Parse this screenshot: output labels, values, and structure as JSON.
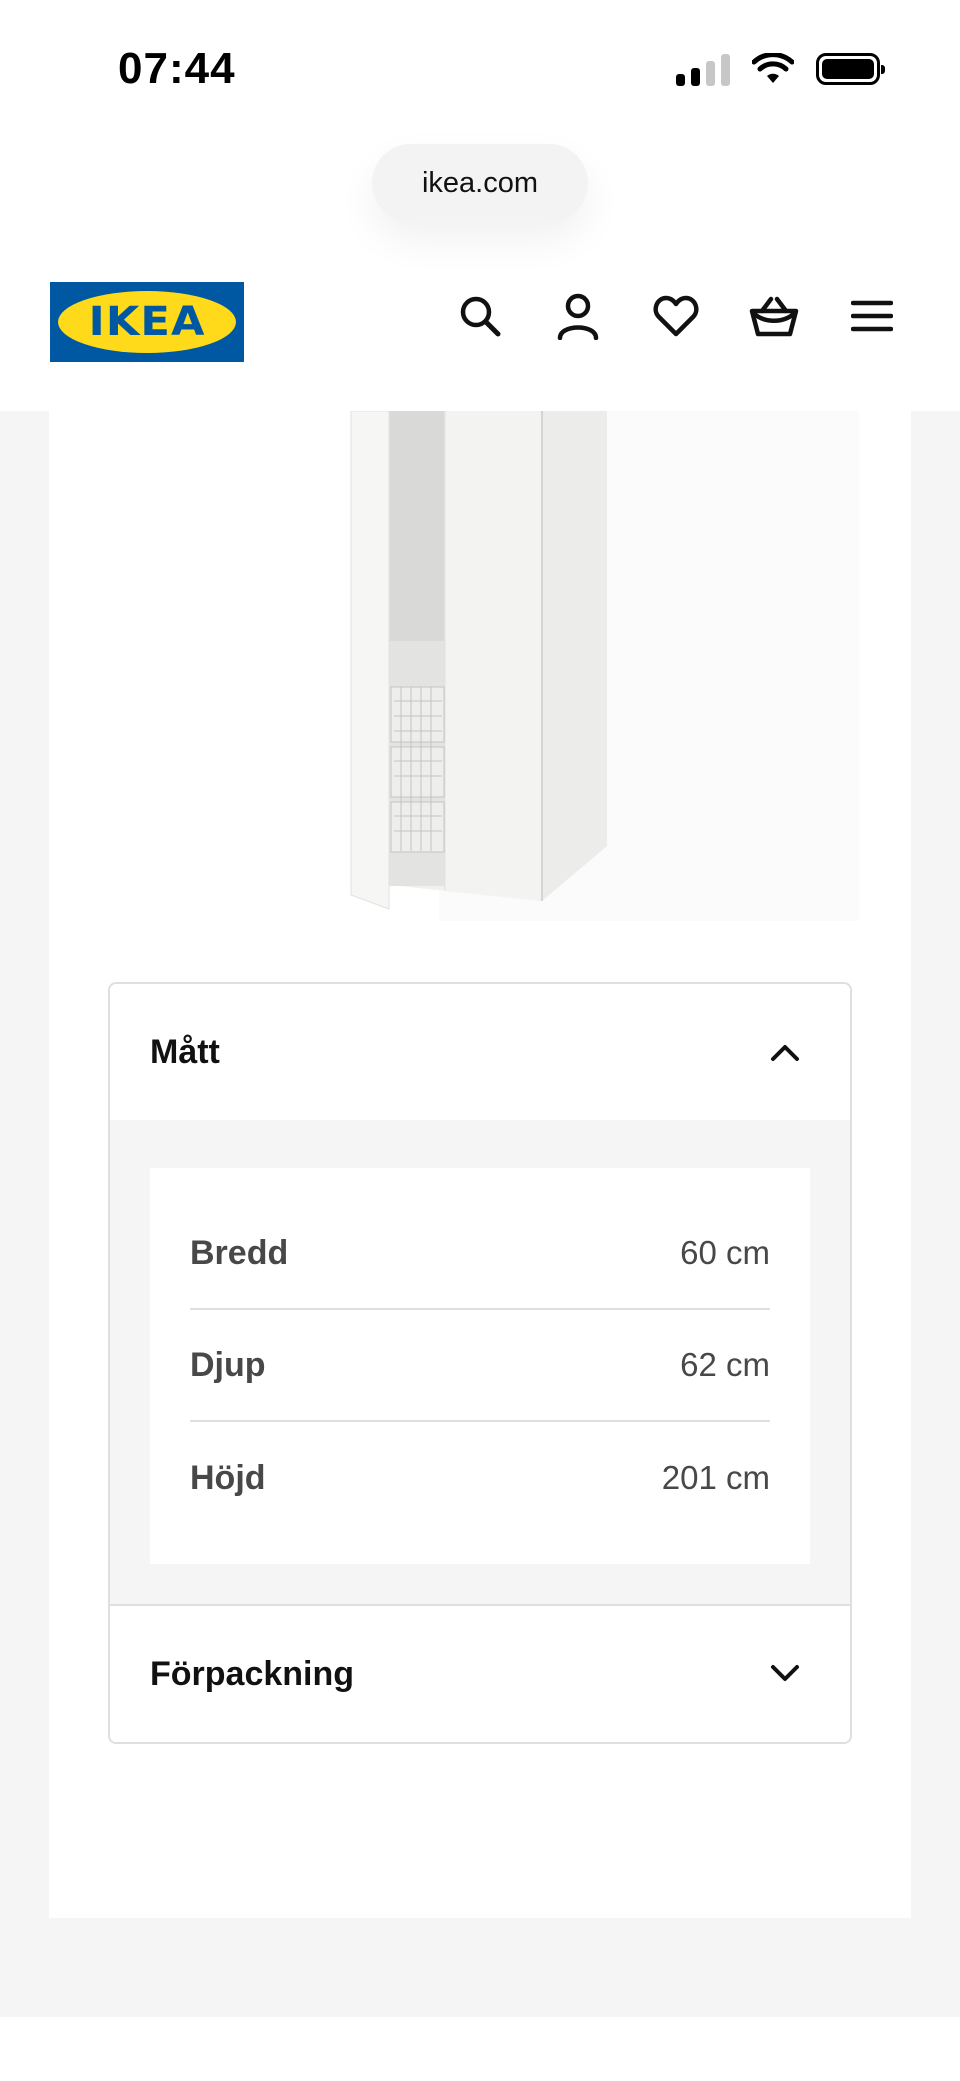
{
  "status_bar": {
    "time": "07:44"
  },
  "browser": {
    "url": "ikea.com"
  },
  "header": {
    "logo_text": "IKEA",
    "icons": [
      "search-icon",
      "account-icon",
      "heart-icon",
      "basket-icon",
      "menu-icon"
    ]
  },
  "product": {
    "image": "white-wardrobe-with-wire-baskets"
  },
  "accordion": {
    "dimensions": {
      "title": "Mått",
      "expanded": true,
      "rows": [
        {
          "label": "Bredd",
          "value": "60 cm"
        },
        {
          "label": "Djup",
          "value": "62 cm"
        },
        {
          "label": "Höjd",
          "value": "201 cm"
        }
      ]
    },
    "packaging": {
      "title": "Förpackning",
      "expanded": false
    }
  },
  "colors": {
    "ikea_blue": "#0058a3",
    "ikea_yellow": "#ffda1a",
    "page_bg": "#f5f5f5",
    "text_secondary": "#484848"
  }
}
